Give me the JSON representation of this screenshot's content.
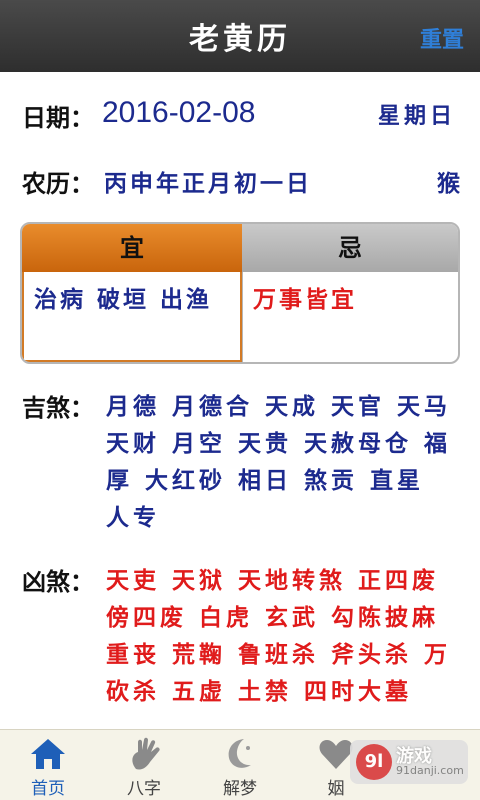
{
  "header": {
    "title": "老黄历",
    "reset_label": "重置"
  },
  "date": {
    "label": "日期：",
    "value": "2016-02-08",
    "weekday": "星期日"
  },
  "lunar": {
    "label": "农历：",
    "value": "丙申年正月初一日",
    "zodiac": "猴"
  },
  "yi_ji": {
    "yi_title": "宜",
    "ji_title": "忌",
    "yi_items": "治病 破垣 出渔",
    "ji_items": "万事皆宜"
  },
  "ji_shen": {
    "label": "吉煞：",
    "text": "月德 月德合 天成 天官 天马 天财 月空 天贵 天赦母仓 福厚 大红砂 相日 煞贡 直星 人专"
  },
  "xiong_sha": {
    "label": "凶煞：",
    "text": "天吏 天狱 天地转煞 正四废 傍四废 白虎 玄武 勾陈披麻 重丧 荒鞠 鲁班杀 斧头杀 万砍杀 五虚 土禁 四时大墓"
  },
  "tabbar": {
    "tabs": [
      {
        "label": "首页",
        "icon": "home-icon",
        "active": true
      },
      {
        "label": "八字",
        "icon": "hand-icon",
        "active": false
      },
      {
        "label": "解梦",
        "icon": "moon-icon",
        "active": false
      },
      {
        "label": "姻",
        "icon": "heart-icon",
        "active": false
      }
    ]
  },
  "watermark": {
    "mark": "9l",
    "name": "游戏",
    "url": "91danji.com"
  },
  "colors": {
    "accent_blue": "#1c2a8e",
    "red": "#e01b1b",
    "orange": "#d27a25",
    "link_blue": "#2f7fd8"
  }
}
